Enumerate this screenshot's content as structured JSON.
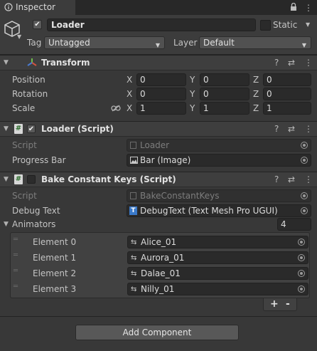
{
  "tab": {
    "label": "Inspector"
  },
  "header": {
    "object_name": "Loader",
    "static_label": "Static",
    "tag_label": "Tag",
    "tag_value": "Untagged",
    "layer_label": "Layer",
    "layer_value": "Default"
  },
  "transform": {
    "title": "Transform",
    "rows": [
      {
        "label": "Position",
        "x": "0",
        "y": "0",
        "z": "0"
      },
      {
        "label": "Rotation",
        "x": "0",
        "y": "0",
        "z": "0"
      },
      {
        "label": "Scale",
        "x": "1",
        "y": "1",
        "z": "1"
      }
    ],
    "axis": {
      "x": "X",
      "y": "Y",
      "z": "Z"
    }
  },
  "loader_script": {
    "title": "Loader (Script)",
    "script_label": "Script",
    "script_value": "Loader",
    "progress_label": "Progress Bar",
    "progress_value": "Bar (Image)"
  },
  "bake_script": {
    "title": "Bake Constant Keys (Script)",
    "script_label": "Script",
    "script_value": "BakeConstantKeys",
    "debug_label": "Debug Text",
    "debug_value": "DebugText (Text Mesh Pro UGUI)",
    "animators_label": "Animators",
    "animators_count": "4",
    "elements": [
      {
        "label": "Element 0",
        "value": "Alice_01"
      },
      {
        "label": "Element 1",
        "value": "Aurora_01"
      },
      {
        "label": "Element 2",
        "value": "Dalae_01"
      },
      {
        "label": "Element 3",
        "value": "Nilly_01"
      }
    ],
    "plus": "+",
    "minus": "-"
  },
  "add_component_label": "Add Component",
  "icons": {
    "help": "?",
    "settings": "⇄",
    "more": "⋮"
  }
}
